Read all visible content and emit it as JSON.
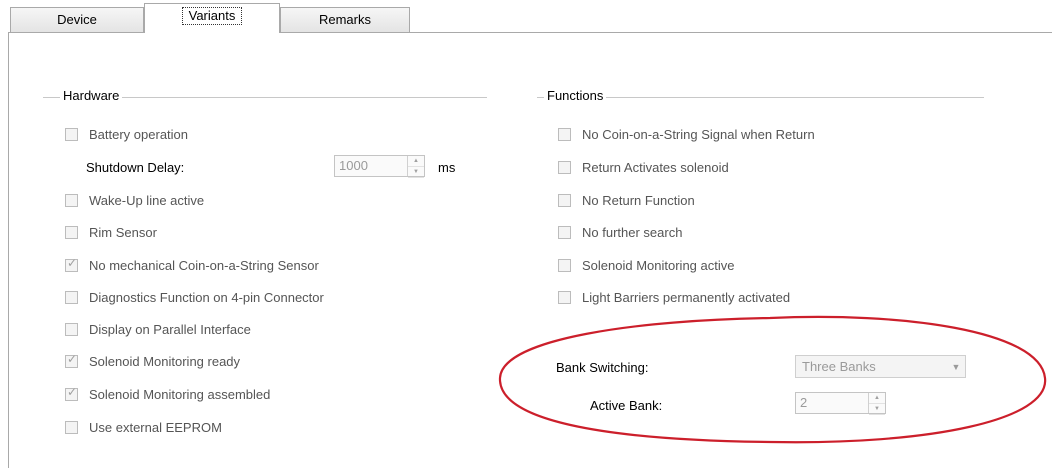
{
  "tabs": [
    {
      "label": "Device",
      "active": false
    },
    {
      "label": "Variants",
      "active": true
    },
    {
      "label": "Remarks",
      "active": false
    }
  ],
  "hardware": {
    "title": "Hardware",
    "battery": {
      "label": "Battery operation",
      "checked": false
    },
    "shutdown": {
      "label": "Shutdown Delay:",
      "value": "1000",
      "unit": "ms"
    },
    "items": [
      {
        "label": "Wake-Up line active",
        "checked": false
      },
      {
        "label": "Rim Sensor",
        "checked": false
      },
      {
        "label": "No mechanical Coin-on-a-String Sensor",
        "checked": true
      },
      {
        "label": "Diagnostics Function on 4-pin Connector",
        "checked": false
      },
      {
        "label": "Display on Parallel Interface",
        "checked": false
      },
      {
        "label": "Solenoid Monitoring ready",
        "checked": true
      },
      {
        "label": "Solenoid Monitoring assembled",
        "checked": true
      },
      {
        "label": "Use external EEPROM",
        "checked": false
      }
    ]
  },
  "functions": {
    "title": "Functions",
    "items": [
      {
        "label": "No Coin-on-a-String Signal when Return",
        "checked": false
      },
      {
        "label": "Return Activates solenoid",
        "checked": false
      },
      {
        "label": "No Return Function",
        "checked": false
      },
      {
        "label": "No further search",
        "checked": false
      },
      {
        "label": "Solenoid Monitoring active",
        "checked": false
      },
      {
        "label": "Light Barriers permanently activated",
        "checked": false
      }
    ],
    "bank_switching": {
      "label": "Bank Switching:",
      "value": "Three Banks"
    },
    "active_bank": {
      "label": "Active Bank:",
      "value": "2"
    }
  },
  "colors": {
    "annotation_ellipse": "#cc1f2b",
    "disabled_text": "#555555"
  },
  "icons": {
    "check": "check-mark-icon",
    "spin_up": "spin-up-icon",
    "spin_down": "spin-down-icon",
    "dropdown": "chevron-down-icon"
  }
}
